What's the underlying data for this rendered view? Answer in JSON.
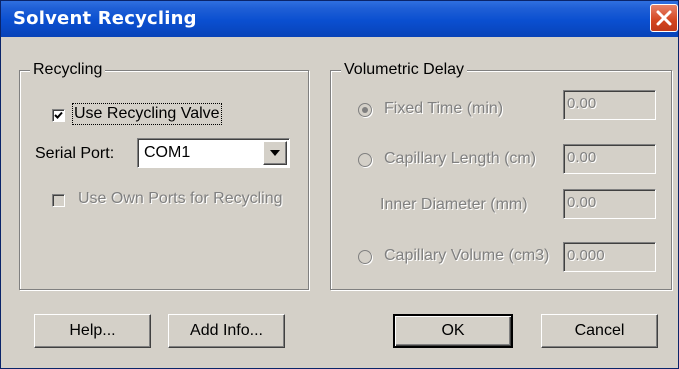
{
  "window": {
    "title": "Solvent Recycling"
  },
  "recycling": {
    "group_title": "Recycling",
    "use_recycling_valve": {
      "label": "Use Recycling Valve",
      "checked": true
    },
    "serial_port": {
      "label": "Serial Port:",
      "value": "COM1"
    },
    "use_own_ports": {
      "label": "Use Own Ports for Recycling",
      "checked": false,
      "enabled": false
    }
  },
  "volumetric_delay": {
    "group_title": "Volumetric Delay",
    "fixed_time": {
      "label": "Fixed Time (min)",
      "value": "0.00",
      "selected": true,
      "enabled": false
    },
    "capillary_length": {
      "label": "Capillary Length (cm)",
      "value": "0.00",
      "selected": false,
      "enabled": false
    },
    "inner_diameter": {
      "label": "Inner Diameter (mm)",
      "value": "0.00",
      "enabled": false
    },
    "capillary_volume": {
      "label": "Capillary Volume (cm3)",
      "value": "0.000",
      "selected": false,
      "enabled": false
    }
  },
  "buttons": {
    "help": "Help...",
    "add_info": "Add Info...",
    "ok": "OK",
    "cancel": "Cancel"
  },
  "colors": {
    "titlebar": "#0a4fd0",
    "dialog_face": "#d4d0c8",
    "close_button": "#d3451f",
    "disabled_text": "#808080"
  },
  "icons": {
    "close": "close-icon",
    "check": "checkmark-icon",
    "dropdown": "chevron-down-icon"
  }
}
